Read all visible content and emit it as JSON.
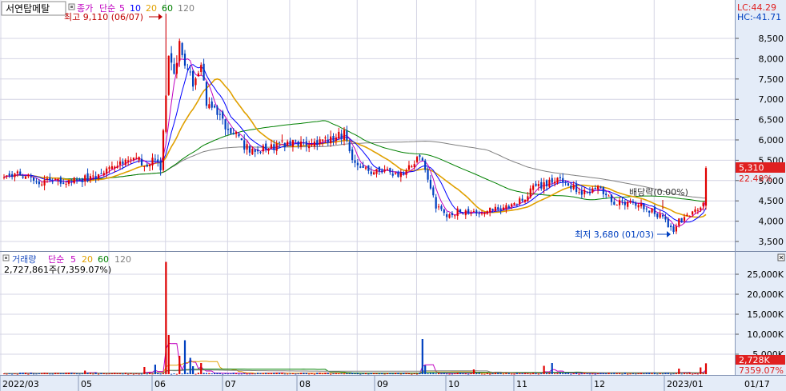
{
  "header": {
    "stock_name": "서연탑메탈",
    "price_label": "종가",
    "ma_label": "단순",
    "ma_periods": [
      "5",
      "10",
      "20",
      "60",
      "120"
    ],
    "ma_colors": [
      "#c000c0",
      "#0000ff",
      "#e0a000",
      "#008000",
      "#808080"
    ],
    "lc": "LC:44.29",
    "hc": "HC:-41.71"
  },
  "annotations": {
    "high": "최고 9,110 (06/07)",
    "low": "최저 3,680 (01/03)",
    "ex_div": "배당락(0.00%)"
  },
  "price_axis": {
    "ticks": [
      "8,500",
      "8,000",
      "7,500",
      "7,000",
      "6,500",
      "6,000",
      "5,500",
      "5,000",
      "4,500",
      "4,000",
      "3,500"
    ],
    "current": "5,310",
    "change": "22.49%"
  },
  "volume_header": {
    "label": "거래량",
    "ma_label": "단순",
    "ma_periods": [
      "5",
      "20",
      "60",
      "120"
    ],
    "value": "2,727,861주(7,359.07%)"
  },
  "volume_axis": {
    "ticks": [
      "25,000K",
      "20,000K",
      "15,000K",
      "10,000K",
      "5,000K"
    ],
    "current": "2,728K",
    "change": "7359.07%"
  },
  "date_axis": {
    "labels": [
      "2022/03",
      "05",
      "06",
      "07",
      "08",
      "09",
      "10",
      "11",
      "12",
      "2023/01",
      "01/17"
    ]
  },
  "colors": {
    "up": "#e00000",
    "down": "#0040c0",
    "grid": "#d4d4e4",
    "axis_bg": "#e4ecf8",
    "current_box": "#e02020"
  },
  "chart_data": {
    "type": "candlestick",
    "price_range": [
      3400,
      9200
    ],
    "volume_range": [
      0,
      28500
    ],
    "volume_unit": "K",
    "high_point": {
      "price": 9110,
      "date": "06/07"
    },
    "low_point": {
      "price": 3680,
      "date": "01/03"
    },
    "last_close": 5310,
    "last_volume_k": 2728,
    "close_anchors": [
      [
        0,
        5080
      ],
      [
        6,
        5150
      ],
      [
        12,
        5000
      ],
      [
        20,
        4950
      ],
      [
        28,
        5020
      ],
      [
        34,
        5150
      ],
      [
        40,
        5280
      ],
      [
        45,
        5450
      ],
      [
        50,
        5500
      ],
      [
        53,
        5380
      ],
      [
        56,
        5550
      ],
      [
        58,
        5200
      ],
      [
        60,
        7200
      ],
      [
        61,
        8200
      ],
      [
        63,
        7600
      ],
      [
        65,
        8300
      ],
      [
        67,
        7800
      ],
      [
        70,
        7400
      ],
      [
        73,
        7950
      ],
      [
        75,
        6900
      ],
      [
        78,
        6750
      ],
      [
        82,
        6350
      ],
      [
        85,
        6200
      ],
      [
        88,
        5900
      ],
      [
        92,
        5750
      ],
      [
        100,
        5850
      ],
      [
        108,
        5950
      ],
      [
        114,
        5850
      ],
      [
        120,
        6050
      ],
      [
        126,
        6150
      ],
      [
        130,
        5350
      ],
      [
        134,
        5280
      ],
      [
        138,
        5200
      ],
      [
        142,
        5350
      ],
      [
        146,
        5050
      ],
      [
        150,
        5400
      ],
      [
        154,
        5550
      ],
      [
        156,
        5280
      ],
      [
        160,
        4380
      ],
      [
        164,
        4120
      ],
      [
        168,
        4250
      ],
      [
        172,
        4180
      ],
      [
        178,
        4250
      ],
      [
        184,
        4300
      ],
      [
        190,
        4420
      ],
      [
        196,
        4800
      ],
      [
        202,
        4950
      ],
      [
        206,
        5050
      ],
      [
        210,
        4850
      ],
      [
        214,
        4700
      ],
      [
        220,
        4800
      ],
      [
        226,
        4480
      ],
      [
        232,
        4450
      ],
      [
        236,
        4380
      ],
      [
        240,
        4250
      ],
      [
        244,
        4080
      ],
      [
        246,
        3880
      ],
      [
        248,
        3750
      ],
      [
        250,
        4000
      ],
      [
        254,
        4150
      ],
      [
        257,
        4250
      ],
      [
        259,
        4380
      ],
      [
        260,
        5310
      ]
    ],
    "volume_spikes_k": [
      [
        60,
        28100
      ],
      [
        61,
        9800
      ],
      [
        65,
        4600
      ],
      [
        67,
        8500
      ],
      [
        69,
        4100
      ],
      [
        70,
        2000
      ],
      [
        73,
        2800
      ],
      [
        52,
        1800
      ],
      [
        56,
        2400
      ],
      [
        30,
        900
      ],
      [
        155,
        8800
      ],
      [
        156,
        2200
      ],
      [
        200,
        2100
      ],
      [
        203,
        2800
      ],
      [
        174,
        1200
      ],
      [
        250,
        1400
      ],
      [
        258,
        1700
      ],
      [
        260,
        2728
      ]
    ]
  }
}
